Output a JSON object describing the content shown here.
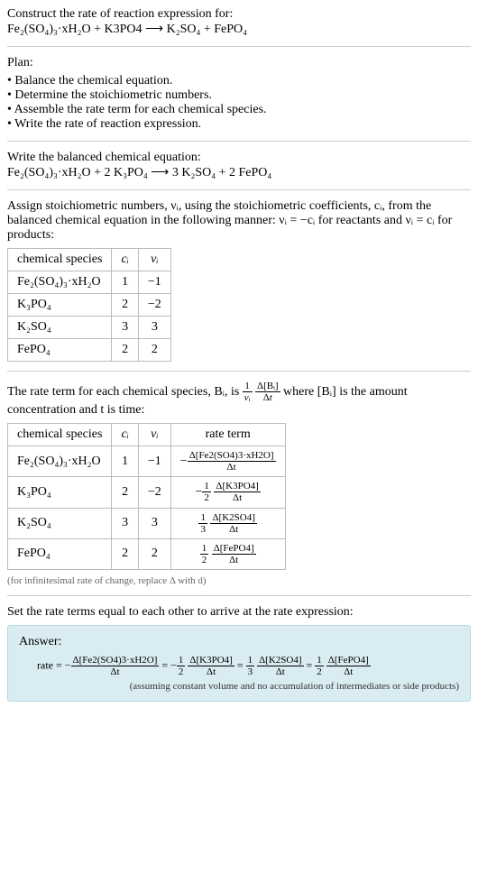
{
  "intro": {
    "construct_label": "Construct the rate of reaction expression for:",
    "equation_unbalanced": "Fe₂(SO₄)₃·xH₂O + K3PO4  ⟶  K₂SO₄ + FePO₄"
  },
  "plan": {
    "heading": "Plan:",
    "items": [
      "Balance the chemical equation.",
      "Determine the stoichiometric numbers.",
      "Assemble the rate term for each chemical species.",
      "Write the rate of reaction expression."
    ]
  },
  "balanced": {
    "heading": "Write the balanced chemical equation:",
    "equation": "Fe₂(SO₄)₃·xH₂O + 2 K₃PO₄  ⟶  3 K₂SO₄ + 2 FePO₄"
  },
  "assign": {
    "text": "Assign stoichiometric numbers, νᵢ, using the stoichiometric coefficients, cᵢ, from the balanced chemical equation in the following manner: νᵢ = −cᵢ for reactants and νᵢ = cᵢ for products:",
    "table_header": [
      "chemical species",
      "cᵢ",
      "νᵢ"
    ],
    "rows": [
      {
        "species": "Fe₂(SO₄)₃·xH₂O",
        "c": "1",
        "nu": "−1"
      },
      {
        "species": "K₃PO₄",
        "c": "2",
        "nu": "−2"
      },
      {
        "species": "K₂SO₄",
        "c": "3",
        "nu": "3"
      },
      {
        "species": "FePO₄",
        "c": "2",
        "nu": "2"
      }
    ]
  },
  "rate_term": {
    "prefix": "The rate term for each chemical species, Bᵢ, is ",
    "suffix": " where [Bᵢ] is the amount concentration and t is time:",
    "table_header": [
      "chemical species",
      "cᵢ",
      "νᵢ",
      "rate term"
    ],
    "rows": [
      {
        "species": "Fe₂(SO₄)₃·xH₂O",
        "c": "1",
        "nu": "−1",
        "term_num": "Δ[Fe2(SO4)3·xH2O]",
        "term_den": "Δt",
        "coef": "−"
      },
      {
        "species": "K₃PO₄",
        "c": "2",
        "nu": "−2",
        "term_num": "Δ[K3PO4]",
        "term_den": "Δt",
        "coef": "−½"
      },
      {
        "species": "K₂SO₄",
        "c": "3",
        "nu": "3",
        "term_num": "Δ[K2SO4]",
        "term_den": "Δt",
        "coef": "⅓"
      },
      {
        "species": "FePO₄",
        "c": "2",
        "nu": "2",
        "term_num": "Δ[FePO4]",
        "term_den": "Δt",
        "coef": "½"
      }
    ],
    "footnote": "(for infinitesimal rate of change, replace Δ with d)"
  },
  "final": {
    "heading": "Set the rate terms equal to each other to arrive at the rate expression:",
    "answer_label": "Answer:",
    "rate_prefix": "rate = ",
    "terms": [
      {
        "sign": "−",
        "coef_num": "",
        "coef_den": "",
        "num": "Δ[Fe2(SO4)3·xH2O]",
        "den": "Δt"
      },
      {
        "sign": "−",
        "coef_num": "1",
        "coef_den": "2",
        "num": "Δ[K3PO4]",
        "den": "Δt"
      },
      {
        "sign": "",
        "coef_num": "1",
        "coef_den": "3",
        "num": "Δ[K2SO4]",
        "den": "Δt"
      },
      {
        "sign": "",
        "coef_num": "1",
        "coef_den": "2",
        "num": "Δ[FePO4]",
        "den": "Δt"
      }
    ],
    "footnote": "(assuming constant volume and no accumulation of intermediates or side products)"
  }
}
